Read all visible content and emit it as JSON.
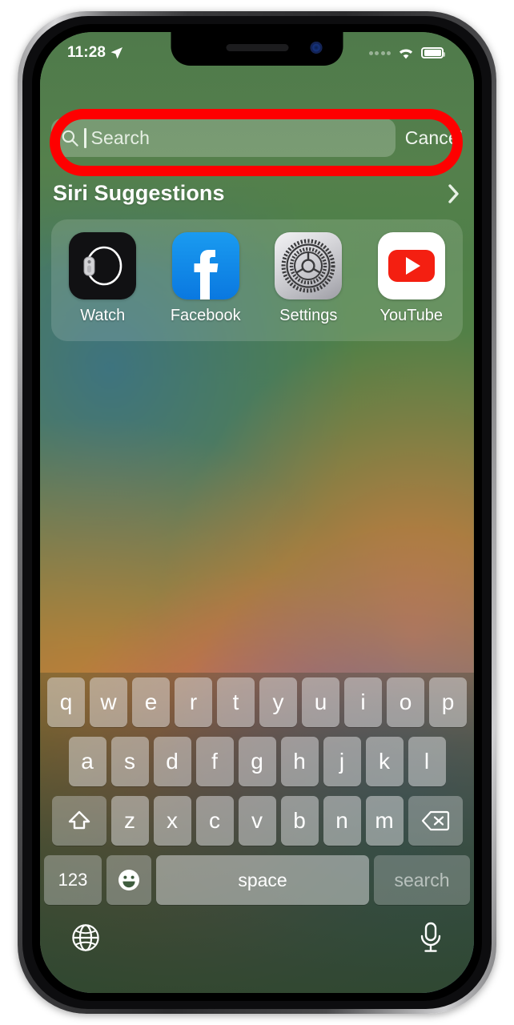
{
  "device": {
    "name": "iphone-x",
    "frame_color": "#3a3a3c"
  },
  "status_bar": {
    "time": "11:28",
    "location_icon": "location-arrow-icon",
    "signal_icon": "cellular-signal-dots-icon",
    "wifi_icon": "wifi-icon",
    "battery_icon": "battery-full-icon"
  },
  "search": {
    "placeholder": "Search",
    "value": "",
    "icon": "magnifier-icon",
    "cancel_label": "Cancel"
  },
  "annotation": {
    "shape": "oval",
    "color": "#fe0000",
    "target": "search-field"
  },
  "siri": {
    "title": "Siri Suggestions",
    "chevron_icon": "chevron-right-icon",
    "apps": [
      {
        "label": "Watch",
        "icon": "apple-watch-app-icon"
      },
      {
        "label": "Facebook",
        "icon": "facebook-app-icon"
      },
      {
        "label": "Settings",
        "icon": "settings-gear-app-icon"
      },
      {
        "label": "YouTube",
        "icon": "youtube-app-icon"
      }
    ]
  },
  "keyboard": {
    "row1": [
      "q",
      "w",
      "e",
      "r",
      "t",
      "y",
      "u",
      "i",
      "o",
      "p"
    ],
    "row2": [
      "a",
      "s",
      "d",
      "f",
      "g",
      "h",
      "j",
      "k",
      "l"
    ],
    "row3": [
      "z",
      "x",
      "c",
      "v",
      "b",
      "n",
      "m"
    ],
    "shift_icon": "shift-arrow-icon",
    "backspace_icon": "backspace-delete-icon",
    "numbers_label": "123",
    "emoji_icon": "emoji-smiley-icon",
    "space_label": "space",
    "return_label": "search",
    "globe_icon": "globe-language-icon",
    "dictation_icon": "microphone-icon"
  },
  "colors": {
    "annotation_red": "#fe0000",
    "wallpaper_green": "#4f7a4b",
    "youtube_red": "#f41f11",
    "facebook_blue": "#1a9bf0"
  }
}
